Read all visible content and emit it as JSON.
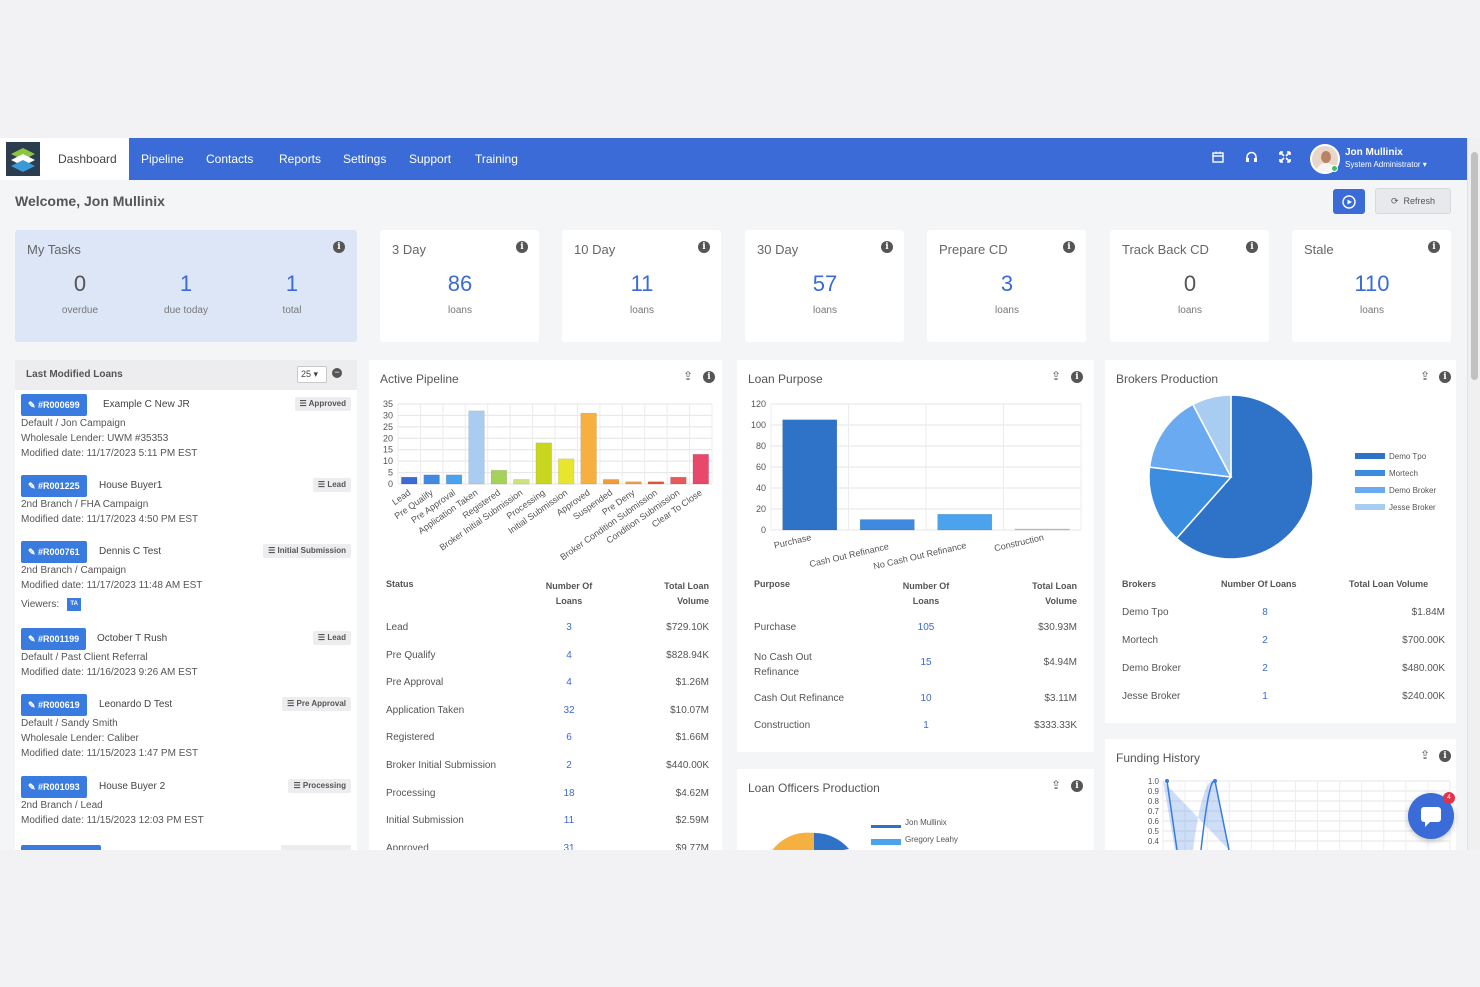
{
  "nav": {
    "items": [
      "Dashboard",
      "Pipeline",
      "Contacts",
      "Reports",
      "Settings",
      "Support",
      "Training"
    ],
    "user_name": "Jon Mullinix",
    "user_role": "System Administrator ▾"
  },
  "header": {
    "welcome": "Welcome, Jon Mullinix",
    "refresh_label": "Refresh"
  },
  "tasks": {
    "title": "My Tasks",
    "stats": [
      {
        "value": "0",
        "label": "overdue"
      },
      {
        "value": "1",
        "label": "due today"
      },
      {
        "value": "1",
        "label": "total"
      }
    ]
  },
  "stat_cards": [
    {
      "title": "3 Day",
      "value": "86",
      "label": "loans"
    },
    {
      "title": "10 Day",
      "value": "11",
      "label": "loans"
    },
    {
      "title": "30 Day",
      "value": "57",
      "label": "loans"
    },
    {
      "title": "Prepare CD",
      "value": "3",
      "label": "loans"
    },
    {
      "title": "Track Back CD",
      "value": "0",
      "label": "loans"
    },
    {
      "title": "Stale",
      "value": "110",
      "label": "loans"
    }
  ],
  "last_modified": {
    "title": "Last Modified Loans",
    "page_size": "25 ▾",
    "loans": [
      {
        "id": "#R000699",
        "name": "Example C New JR",
        "status": "Approved",
        "line1": "Default  /  Jon Campaign",
        "line2": "Wholesale Lender: UWM #35353",
        "line3": "Modified date: 11/17/2023 5:11 PM EST"
      },
      {
        "id": "#R001225",
        "name": "House Buyer1",
        "status": "Lead",
        "line1": "2nd Branch  /  FHA Campaign",
        "line2": "Modified date: 11/17/2023 4:50 PM EST",
        "line3": ""
      },
      {
        "id": "#R000761",
        "name": "Dennis C Test",
        "status": "Initial Submission",
        "line1": "2nd Branch  /  Campaign",
        "line2": "Modified date: 11/17/2023 11:48 AM EST",
        "line3": "Viewers:"
      },
      {
        "id": "#R001199",
        "name": "October T Rush",
        "status": "Lead",
        "line1": "Default  /  Past Client Referral",
        "line2": "Modified date: 11/16/2023 9:26 AM EST",
        "line3": ""
      },
      {
        "id": "#R000619",
        "name": "Leonardo D Test",
        "status": "Pre Approval",
        "line1": "Default  /  Sandy Smith",
        "line2": "Wholesale Lender: Caliber",
        "line3": "Modified date: 11/15/2023 1:47 PM EST"
      },
      {
        "id": "#R001093",
        "name": "House Buyer 2",
        "status": "Processing",
        "line1": "2nd Branch  /  Lead",
        "line2": "Modified date: 11/15/2023 12:03 PM EST",
        "line3": ""
      }
    ],
    "viewer_initials": "TA"
  },
  "active_pipeline": {
    "title": "Active Pipeline",
    "columns": [
      "Status",
      "Number Of Loans",
      "Total Loan Volume"
    ],
    "rows": [
      [
        "Lead",
        "3",
        "$729.10K"
      ],
      [
        "Pre Qualify",
        "4",
        "$828.94K"
      ],
      [
        "Pre Approval",
        "4",
        "$1.26M"
      ],
      [
        "Application Taken",
        "32",
        "$10.07M"
      ],
      [
        "Registered",
        "6",
        "$1.66M"
      ],
      [
        "Broker Initial Submission",
        "2",
        "$440.00K"
      ],
      [
        "Processing",
        "18",
        "$4.62M"
      ],
      [
        "Initial Submission",
        "11",
        "$2.59M"
      ],
      [
        "Approved",
        "31",
        "$9.77M"
      ]
    ]
  },
  "loan_purpose": {
    "title": "Loan Purpose",
    "columns": [
      "Purpose",
      "Number Of Loans",
      "Total Loan Volume"
    ],
    "rows": [
      [
        "Purchase",
        "105",
        "$30.93M"
      ],
      [
        "No Cash Out Refinance",
        "15",
        "$4.94M"
      ],
      [
        "Cash Out Refinance",
        "10",
        "$3.11M"
      ],
      [
        "Construction",
        "1",
        "$333.33K"
      ]
    ]
  },
  "brokers_production": {
    "title": "Brokers Production",
    "columns": [
      "Brokers",
      "Number Of Loans",
      "Total Loan Volume"
    ],
    "rows": [
      [
        "Demo Tpo",
        "8",
        "$1.84M"
      ],
      [
        "Mortech",
        "2",
        "$700.00K"
      ],
      [
        "Demo Broker",
        "2",
        "$480.00K"
      ],
      [
        "Jesse Broker",
        "1",
        "$240.00K"
      ]
    ]
  },
  "funding_history": {
    "title": "Funding History"
  },
  "loan_officers": {
    "title": "Loan Officers Production",
    "legend": [
      "Jon Mullinix",
      "Gregory Leahy"
    ]
  },
  "chart_data": [
    {
      "type": "bar",
      "title": "Active Pipeline",
      "categories": [
        "Lead",
        "Pre Qualify",
        "Pre Approval",
        "Application Taken",
        "Registered",
        "Broker Initial Submission",
        "Processing",
        "Initial Submission",
        "Approved",
        "Suspended",
        "Pre Deny",
        "Broker Condition Submission",
        "Condition Submission",
        "Clear To Close"
      ],
      "values": [
        3,
        4,
        4,
        32,
        6,
        2,
        18,
        11,
        31,
        2,
        1,
        1,
        3,
        13
      ],
      "colors": [
        "#3a6bd6",
        "#3f8ae0",
        "#4aa3ec",
        "#a9cdf0",
        "#a6d25a",
        "#cde27a",
        "#c8d620",
        "#e7e52c",
        "#f5b040",
        "#f39a3a",
        "#f19b4d",
        "#e3573b",
        "#e85a5a",
        "#e8486a"
      ],
      "ylim": [
        0,
        35
      ],
      "yticks": [
        0,
        5,
        10,
        15,
        20,
        25,
        30,
        35
      ]
    },
    {
      "type": "bar",
      "title": "Loan Purpose",
      "categories": [
        "Purchase",
        "Cash Out Refinance",
        "No Cash Out Refinance",
        "Construction"
      ],
      "values": [
        105,
        10,
        15,
        1
      ],
      "colors": [
        "#2f73c9",
        "#3f8ae0",
        "#4aa3ec",
        "#a9cdf0"
      ],
      "ylim": [
        0,
        120
      ],
      "yticks": [
        0,
        20,
        40,
        60,
        80,
        100,
        120
      ]
    },
    {
      "type": "pie",
      "title": "Brokers Production",
      "labels": [
        "Demo Tpo",
        "Mortech",
        "Demo Broker",
        "Jesse Broker"
      ],
      "values": [
        8,
        2,
        2,
        1
      ],
      "colors": [
        "#2f73c9",
        "#3b8de0",
        "#6aaaf0",
        "#a9cdf0"
      ],
      "legend": "right"
    },
    {
      "type": "line",
      "title": "Funding History",
      "yticks": [
        0.4,
        0.5,
        0.6,
        0.7,
        0.8,
        0.9,
        1.0
      ],
      "color": "#3a7be0"
    }
  ]
}
